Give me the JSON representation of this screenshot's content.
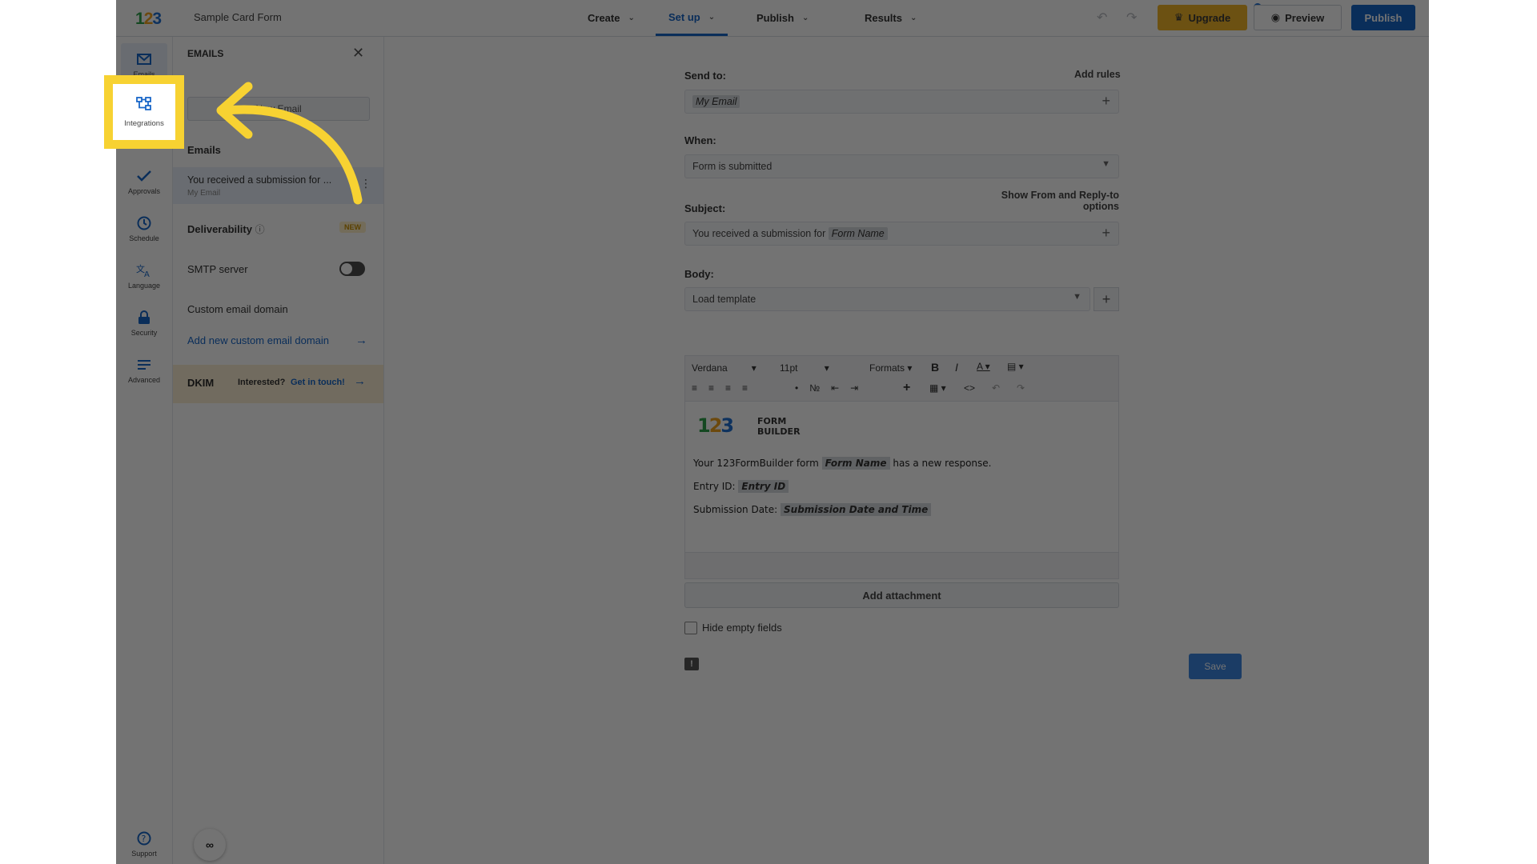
{
  "topbar": {
    "logo": {
      "d1": "1",
      "d2": "2",
      "d3": "3"
    },
    "form_title": "Sample Card Form",
    "tabs": [
      {
        "label": "Create"
      },
      {
        "label": "Set up",
        "active": true
      },
      {
        "label": "Publish"
      },
      {
        "label": "Results"
      }
    ],
    "upgrade_label": "Upgrade",
    "preview_label": "Preview",
    "publish_label": "Publish"
  },
  "rail": {
    "items": [
      {
        "label": "Emails",
        "icon": "envelope-icon"
      },
      {
        "label": "Approvals",
        "icon": "check-icon"
      },
      {
        "label": "Schedule",
        "icon": "clock-icon"
      },
      {
        "label": "Language",
        "icon": "translate-icon"
      },
      {
        "label": "Security",
        "icon": "lock-icon"
      },
      {
        "label": "Advanced",
        "icon": "lines-icon"
      }
    ],
    "support_label": "Support"
  },
  "highlight": {
    "label": "Integrations",
    "icon": "integrations-icon",
    "color": "#f7d232"
  },
  "panel": {
    "title": "EMAILS",
    "new_email_label": "New Email",
    "emails_heading": "Emails",
    "email_item": {
      "subject": "You received a submission for ...",
      "recipient": "My Email"
    },
    "deliverability_label": "Deliverability",
    "new_badge": "NEW",
    "smtp_label": "SMTP server",
    "custom_domain_label": "Custom email domain",
    "add_domain_link": "Add new custom email domain",
    "dkim_label": "DKIM",
    "dkim_interested": "Interested?",
    "dkim_link": "Get in touch!"
  },
  "main": {
    "send_to_label": "Send to:",
    "add_rules_label": "Add rules",
    "send_to_tag": "My Email",
    "when_label": "When:",
    "when_value": "Form is submitted",
    "show_from_link": "Show From and Reply-to options",
    "subject_label": "Subject:",
    "subject_prefix": "You received a submission for",
    "subject_tag": "Form Name",
    "body_label": "Body:",
    "load_template": "Load template",
    "toolbar": {
      "font": "Verdana",
      "size": "11pt",
      "formats": "Formats"
    },
    "editor": {
      "logo_line1": "FORM",
      "logo_line2": "BUILDER",
      "line1_prefix": "Your 123FormBuilder form",
      "line1_tag": "Form Name",
      "line1_suffix": "has a new response.",
      "line2_prefix": "Entry ID:",
      "line2_tag": "Entry ID",
      "line3_prefix": "Submission Date:",
      "line3_tag": "Submission Date and Time"
    },
    "add_attachment_label": "Add attachment",
    "hide_empty_label": "Hide empty fields",
    "save_label": "Save"
  },
  "colors": {
    "accent": "#1866c8",
    "upgrade": "#f0b429",
    "highlight": "#f7d232",
    "overlay": "rgba(0,0,0,0.55)"
  }
}
